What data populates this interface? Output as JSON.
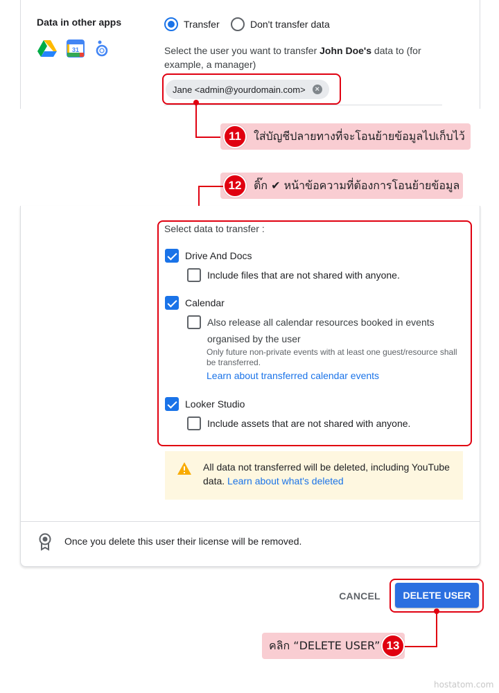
{
  "data_section": {
    "title": "Data in other apps",
    "app_icons": [
      "google-drive-icon",
      "google-calendar-icon",
      "looker-studio-icon"
    ],
    "calendar_icon_text": "31",
    "transfer_option": "Transfer",
    "no_transfer_option": "Don't transfer data",
    "selected_option": "Transfer",
    "helper_prefix": "Select the user you want to transfer ",
    "helper_user": "John Doe's",
    "helper_suffix": " data to (for example, a manager)",
    "recipient_chip": "Jane <admin@yourdomain.com>"
  },
  "select_data": {
    "label": "Select data to transfer :",
    "drive": {
      "label": "Drive And Docs",
      "checked": true,
      "sub_label": "Include files that are not shared with anyone.",
      "sub_checked": false
    },
    "calendar": {
      "label": "Calendar",
      "checked": true,
      "sub_label_line1": "Also release all calendar resources booked in events",
      "sub_label_line2": "organised by the user",
      "sub_checked": false,
      "note": "Only future non-private events with at least one guest/resource shall be transferred.",
      "link": "Learn about transferred calendar events"
    },
    "looker": {
      "label": "Looker Studio",
      "checked": true,
      "sub_label": "Include assets that are not shared with anyone.",
      "sub_checked": false
    }
  },
  "warning": {
    "icon": "warning-triangle-icon",
    "text_line1": "All data not transferred will be deleted, including YouTube",
    "text_prefix": "data. ",
    "link": "Learn about what's deleted"
  },
  "license": {
    "icon": "license-badge-icon",
    "text": "Once you delete this user their license will be removed."
  },
  "actions": {
    "cancel": "CANCEL",
    "delete": "DELETE USER"
  },
  "annotations": {
    "step11": {
      "number": "11",
      "text": "ใส่บัญชีปลายทางที่จะโอนย้ายข้อมูลไปเก็บไว้"
    },
    "step12": {
      "number": "12",
      "text_prefix": "ติ๊ก ",
      "check_symbol": "✔",
      "text_suffix": " หน้าข้อความที่ต้องการโอนย้ายข้อมูล"
    },
    "step13": {
      "number": "13",
      "text": "คลิก “DELETE USER”"
    }
  },
  "watermark": "hostatom.com",
  "colors": {
    "accent": "#1a73e8",
    "annotation_red": "#e00010",
    "annotation_bg": "#f9cdd2",
    "warning_bg": "#fef7e0",
    "delete_button": "#2b6fe0"
  }
}
